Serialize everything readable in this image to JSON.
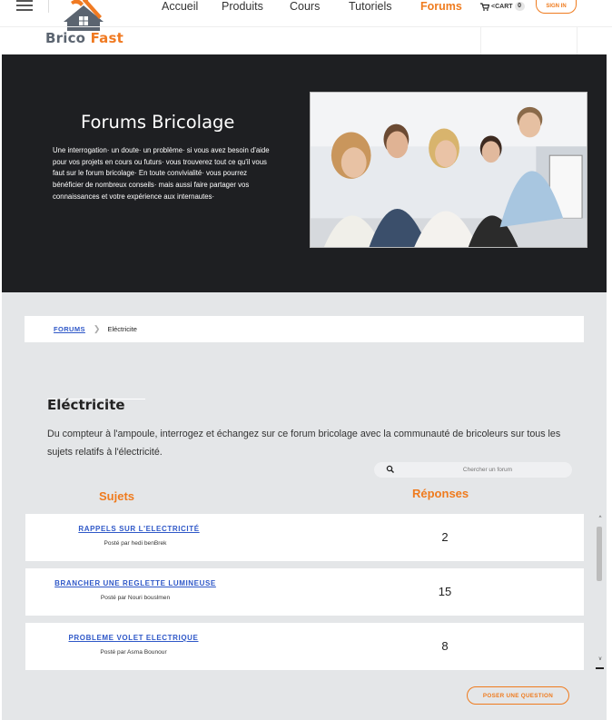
{
  "header": {
    "brand_part1": "Brico",
    "brand_part2": "Fast",
    "nav": [
      "Accueil",
      "Produits",
      "Cours",
      "Tutoriels",
      "Forums"
    ],
    "active_nav": "Forums",
    "cart_label": "CART",
    "cart_count": "0",
    "signin_label": "SIGN IN"
  },
  "hero": {
    "title": "Forums Bricolage",
    "text": "Une interrogation· un doute· un problème· si vous avez besoin d'aide pour vos projets en cours ou futurs· vous trouverez tout ce qu'il vous faut sur le forum bricolage· En toute convivialité· vous pourrez bénéficier de nombreux conseils· mais aussi faire partager vos connaissances et votre expérience aux internautes·"
  },
  "breadcrumb": {
    "root": "FORUMS",
    "current": "Eléctricite"
  },
  "category": {
    "title": "Eléctricite",
    "description": "Du compteur à l'ampoule, interrogez et échangez sur ce forum bricolage avec la communauté de bricoleurs sur tous les sujets relatifs à l'électricité."
  },
  "search": {
    "placeholder": "Chercher un forum"
  },
  "columns": {
    "topics": "Sujets",
    "replies": "Réponses"
  },
  "topics": [
    {
      "title": "RAPPELS SUR L'ELECTRICITÉ",
      "author": "Posté par hedi benBrek",
      "replies": "2"
    },
    {
      "title": "BRANCHER UNE REGLETTE LUMINEUSE",
      "author": "Posté par Nouri bouslmen",
      "replies": "15"
    },
    {
      "title": "PROBLEME VOLET ELECTRIQUE",
      "author": "Posté par Asma Bounour",
      "replies": "8"
    }
  ],
  "ask_button": "POSER UNE QUESTION",
  "colors": {
    "accent": "#ef7b1e",
    "link": "#2f58c8",
    "hero_bg": "#1e1f22",
    "section_bg": "#e4e6e8"
  }
}
